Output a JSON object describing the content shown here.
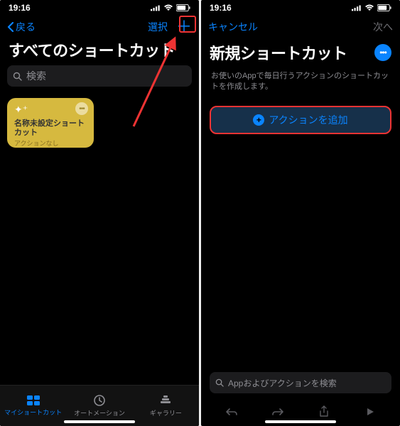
{
  "left": {
    "status": {
      "time": "19:16"
    },
    "nav": {
      "back": "戻る",
      "select": "選択"
    },
    "title": "すべてのショートカット",
    "search_placeholder": "検索",
    "card": {
      "title": "名称未設定ショートカット",
      "subtitle": "アクションなし"
    },
    "tabs": [
      {
        "label": "マイショートカット"
      },
      {
        "label": "オートメーション"
      },
      {
        "label": "ギャラリー"
      }
    ]
  },
  "right": {
    "status": {
      "time": "19:16"
    },
    "nav": {
      "cancel": "キャンセル",
      "next": "次へ"
    },
    "title": "新規ショートカット",
    "subtitle": "お使いのAppで毎日行うアクションのショートカットを作成します。",
    "action_button": "アクションを追加",
    "bottom_search_placeholder": "Appおよびアクションを検索"
  }
}
